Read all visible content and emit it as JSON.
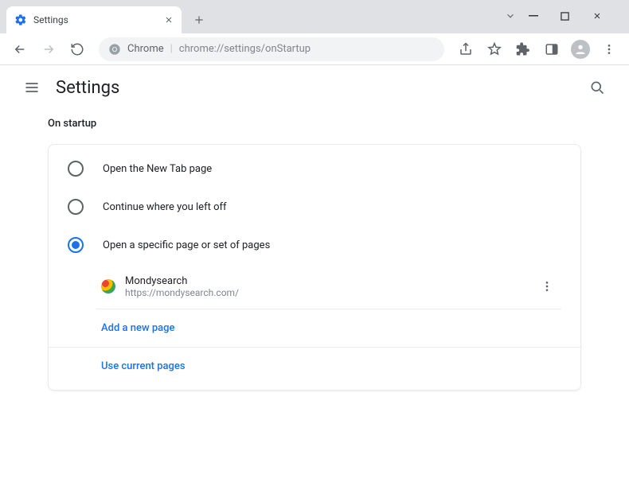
{
  "window": {
    "tab_title": "Settings"
  },
  "toolbar": {
    "chrome_label": "Chrome",
    "url": "chrome://settings/onStartup"
  },
  "header": {
    "title": "Settings"
  },
  "startup": {
    "section_title": "On startup",
    "options": {
      "new_tab": "Open the New Tab page",
      "continue": "Continue where you left off",
      "specific": "Open a specific page or set of pages"
    },
    "pages": [
      {
        "name": "Mondysearch",
        "url": "https://mondysearch.com/"
      }
    ],
    "add_label": "Add a new page",
    "use_current_label": "Use current pages"
  }
}
